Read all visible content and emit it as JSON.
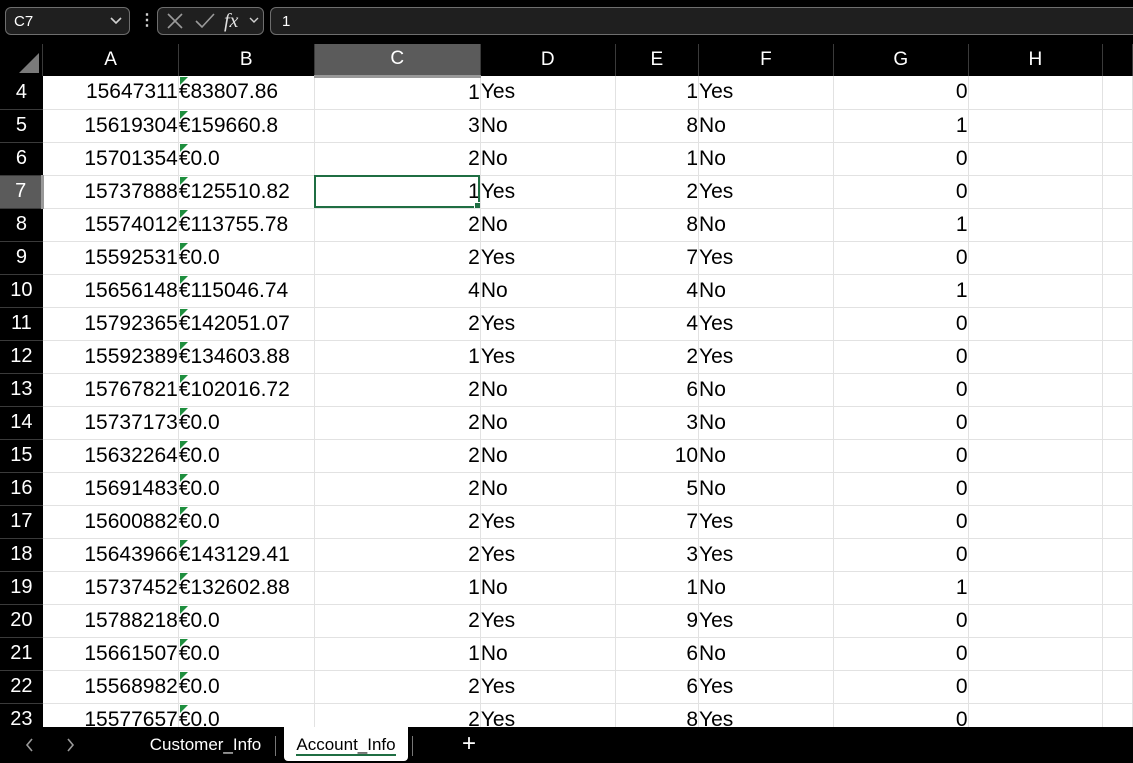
{
  "formula_bar": {
    "name_box": "C7",
    "formula_value": "1",
    "icons": [
      "chevron-down-icon",
      "more-vertical-icon",
      "cancel-x-icon",
      "enter-check-icon",
      "function-fx-icon"
    ]
  },
  "columns": [
    "A",
    "B",
    "C",
    "D",
    "E",
    "F",
    "G",
    "H"
  ],
  "active_column": "C",
  "active_row": "7",
  "rows": [
    {
      "n": "4",
      "A": "15647311",
      "B": "€83807.86",
      "C": "1",
      "D": "Yes",
      "E": "1",
      "F": "Yes",
      "G": "0"
    },
    {
      "n": "5",
      "A": "15619304",
      "B": "€159660.8",
      "C": "3",
      "D": "No",
      "E": "8",
      "F": "No",
      "G": "1"
    },
    {
      "n": "6",
      "A": "15701354",
      "B": "€0.0",
      "C": "2",
      "D": "No",
      "E": "1",
      "F": "No",
      "G": "0"
    },
    {
      "n": "7",
      "A": "15737888",
      "B": "€125510.82",
      "C": "1",
      "D": "Yes",
      "E": "2",
      "F": "Yes",
      "G": "0"
    },
    {
      "n": "8",
      "A": "15574012",
      "B": "€113755.78",
      "C": "2",
      "D": "No",
      "E": "8",
      "F": "No",
      "G": "1"
    },
    {
      "n": "9",
      "A": "15592531",
      "B": "€0.0",
      "C": "2",
      "D": "Yes",
      "E": "7",
      "F": "Yes",
      "G": "0"
    },
    {
      "n": "10",
      "A": "15656148",
      "B": "€115046.74",
      "C": "4",
      "D": "No",
      "E": "4",
      "F": "No",
      "G": "1"
    },
    {
      "n": "11",
      "A": "15792365",
      "B": "€142051.07",
      "C": "2",
      "D": "Yes",
      "E": "4",
      "F": "Yes",
      "G": "0"
    },
    {
      "n": "12",
      "A": "15592389",
      "B": "€134603.88",
      "C": "1",
      "D": "Yes",
      "E": "2",
      "F": "Yes",
      "G": "0"
    },
    {
      "n": "13",
      "A": "15767821",
      "B": "€102016.72",
      "C": "2",
      "D": "No",
      "E": "6",
      "F": "No",
      "G": "0"
    },
    {
      "n": "14",
      "A": "15737173",
      "B": "€0.0",
      "C": "2",
      "D": "No",
      "E": "3",
      "F": "No",
      "G": "0"
    },
    {
      "n": "15",
      "A": "15632264",
      "B": "€0.0",
      "C": "2",
      "D": "No",
      "E": "10",
      "F": "No",
      "G": "0"
    },
    {
      "n": "16",
      "A": "15691483",
      "B": "€0.0",
      "C": "2",
      "D": "No",
      "E": "5",
      "F": "No",
      "G": "0"
    },
    {
      "n": "17",
      "A": "15600882",
      "B": "€0.0",
      "C": "2",
      "D": "Yes",
      "E": "7",
      "F": "Yes",
      "G": "0"
    },
    {
      "n": "18",
      "A": "15643966",
      "B": "€143129.41",
      "C": "2",
      "D": "Yes",
      "E": "3",
      "F": "Yes",
      "G": "0"
    },
    {
      "n": "19",
      "A": "15737452",
      "B": "€132602.88",
      "C": "1",
      "D": "No",
      "E": "1",
      "F": "No",
      "G": "1"
    },
    {
      "n": "20",
      "A": "15788218",
      "B": "€0.0",
      "C": "2",
      "D": "Yes",
      "E": "9",
      "F": "Yes",
      "G": "0"
    },
    {
      "n": "21",
      "A": "15661507",
      "B": "€0.0",
      "C": "1",
      "D": "No",
      "E": "6",
      "F": "No",
      "G": "0"
    },
    {
      "n": "22",
      "A": "15568982",
      "B": "€0.0",
      "C": "2",
      "D": "Yes",
      "E": "6",
      "F": "Yes",
      "G": "0"
    },
    {
      "n": "23",
      "A": "15577657",
      "B": "€0.0",
      "C": "2",
      "D": "Yes",
      "E": "8",
      "F": "Yes",
      "G": "0"
    }
  ],
  "sheet_tabs": [
    {
      "label": "Customer_Info",
      "active": false
    },
    {
      "label": "Account_Info",
      "active": true
    }
  ],
  "colors": {
    "selection": "#1f6e43",
    "error_marker": "#1e8e3e",
    "header_bg": "#000000",
    "active_header_bg": "#5b5b5b"
  }
}
